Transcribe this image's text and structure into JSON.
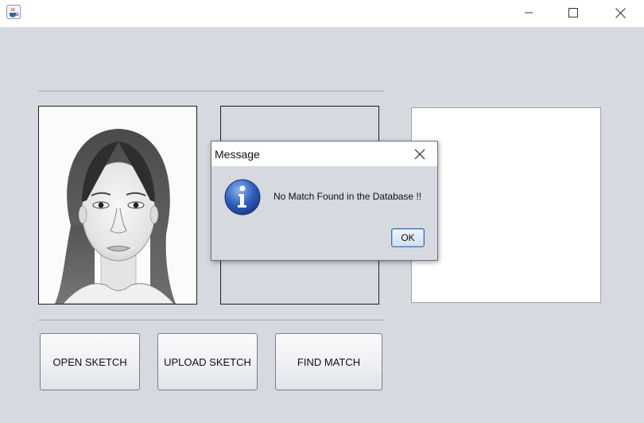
{
  "window": {
    "icon": "java-cup-icon",
    "controls": [
      "minimize-icon",
      "maximize-icon",
      "close-icon"
    ]
  },
  "buttons": {
    "open_sketch": "OPEN SKETCH",
    "upload_sketch": "UPLOAD SKETCH",
    "find_match": "FIND MATCH"
  },
  "dialog": {
    "title": "Message",
    "message": "No Match Found in the Database !!",
    "ok_label": "OK",
    "icon": "info-icon"
  },
  "panels": {
    "sketch_image": "pencil-sketch-portrait",
    "upload_image": "",
    "match_image": ""
  },
  "colors": {
    "background": "#d6d9e0",
    "accent": "#3f6fa8"
  }
}
